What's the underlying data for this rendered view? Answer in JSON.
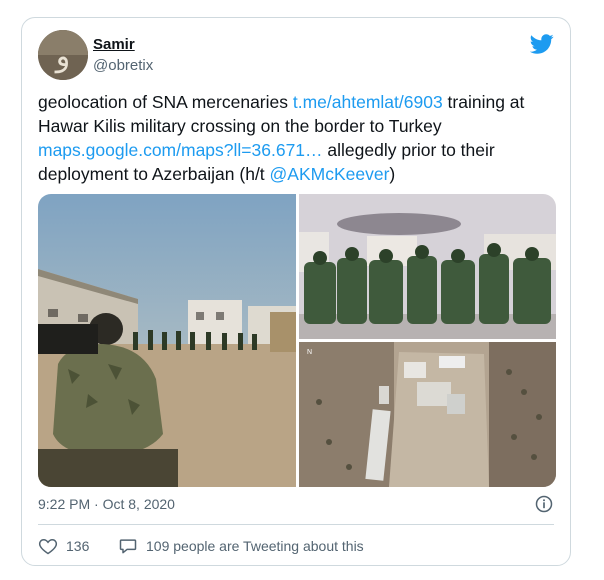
{
  "user": {
    "name": "Samir",
    "handle": "@obretix"
  },
  "tweet": {
    "text_1": "geolocation of SNA mercenaries ",
    "link_1": "t.me/ahtemlat/6903",
    "text_2": " training at Hawar Kilis military crossing on the border to Turkey ",
    "link_2": "maps.google.com/maps?ll=36.671…",
    "text_3": " allegedly prior to their deployment to Azerbaijan (h/t ",
    "mention": "@AKMcKeever",
    "text_4": ")"
  },
  "meta": {
    "timestamp": "9:22 PM · Oct 8, 2020"
  },
  "actions": {
    "likes": "136",
    "talking": "109 people are Tweeting about this"
  },
  "media": {
    "map_label": "N"
  },
  "colors": {
    "accent": "#1d9bf0",
    "muted": "#536471",
    "border": "#cfd9de"
  },
  "icons": [
    "avatar",
    "twitter-bird-icon",
    "info-icon",
    "heart-icon",
    "speech-bubble-icon"
  ]
}
